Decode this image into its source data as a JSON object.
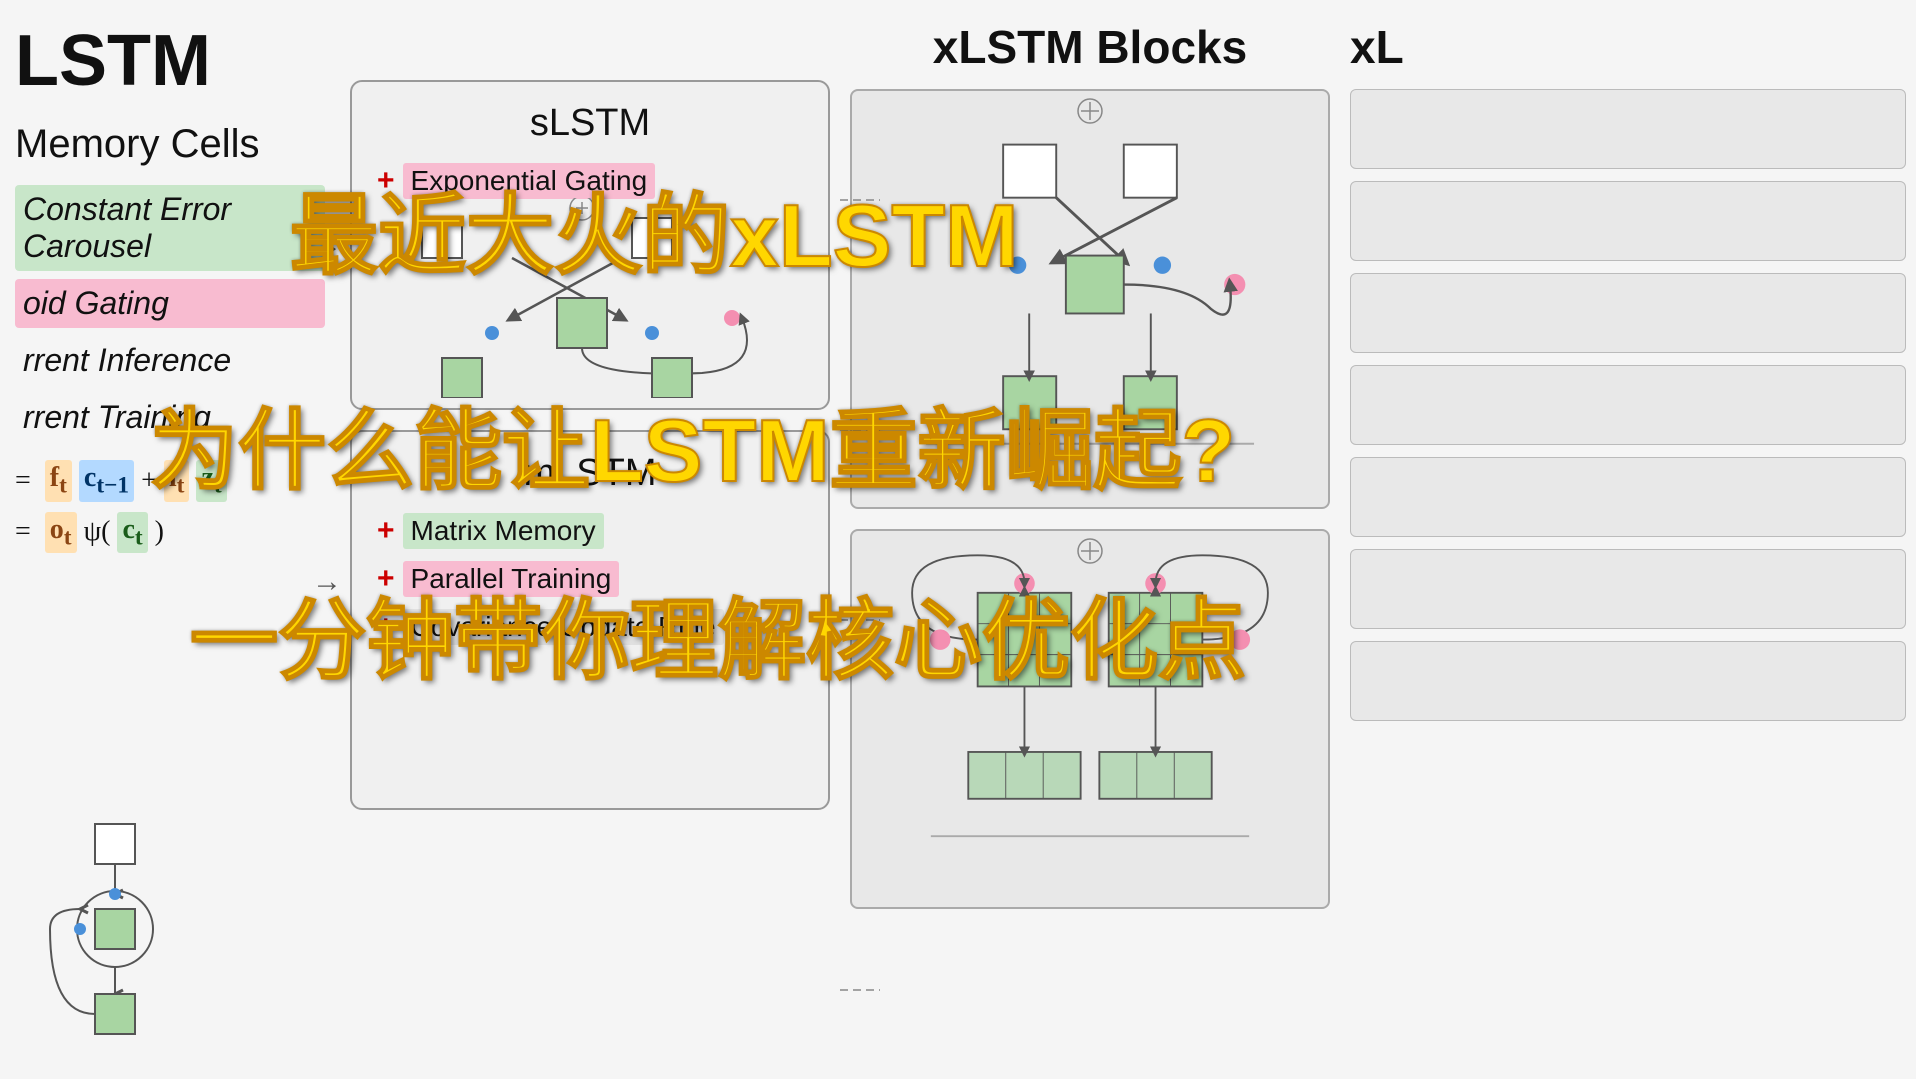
{
  "panels": {
    "left": {
      "title": "LSTM",
      "section_title": "Memory Cells",
      "features": [
        {
          "text": "Constant Error Carousel",
          "style": "highlight-green"
        },
        {
          "text": "oid Gating",
          "style": "highlight-pink"
        },
        {
          "text": "Current Inference",
          "style": "plain"
        },
        {
          "text": "Current Training",
          "style": "plain"
        }
      ],
      "formulas": [
        {
          "lhs": "= ",
          "terms": [
            "f_t",
            " c_{t-1}",
            " + ",
            "i_t",
            " z_t"
          ]
        },
        {
          "lhs": "= ",
          "terms": [
            "o_t",
            " ψ( ",
            "c_t",
            " )"
          ]
        }
      ]
    },
    "middle": {
      "slstm": {
        "title": "sLSTM",
        "features": [
          {
            "prefix": "+",
            "text": "Exponential Gating",
            "style": "green"
          },
          {
            "prefix": "+",
            "text": "最近大火的xLSTM",
            "style": "yellow-overlay"
          }
        ]
      },
      "mlstm": {
        "title": "mLSTM",
        "features": [
          {
            "prefix": "+",
            "text": "Matrix Memory",
            "style": "green"
          },
          {
            "prefix": "+",
            "text": "Parallel Training",
            "style": "pink"
          },
          {
            "prefix": "+",
            "text": "Covariance Update Rule",
            "style": "plain"
          }
        ]
      }
    },
    "right": {
      "title": "xLSTM Blocks"
    },
    "far_right": {
      "title": "xL"
    }
  },
  "overlay": {
    "text1": "最近大火的xLSTM",
    "text2": "为什么能让LSTM重新崛起?",
    "text3": "一分钟带你理解核心优化点"
  },
  "colors": {
    "yellow": "#FFD700",
    "green_bg": "#c8e6c9",
    "pink_bg": "#f8bbd0",
    "blue_var": "#b3d9ff",
    "orange_var": "#ffe0b2",
    "border": "#999999",
    "background": "#f5f5f5"
  }
}
